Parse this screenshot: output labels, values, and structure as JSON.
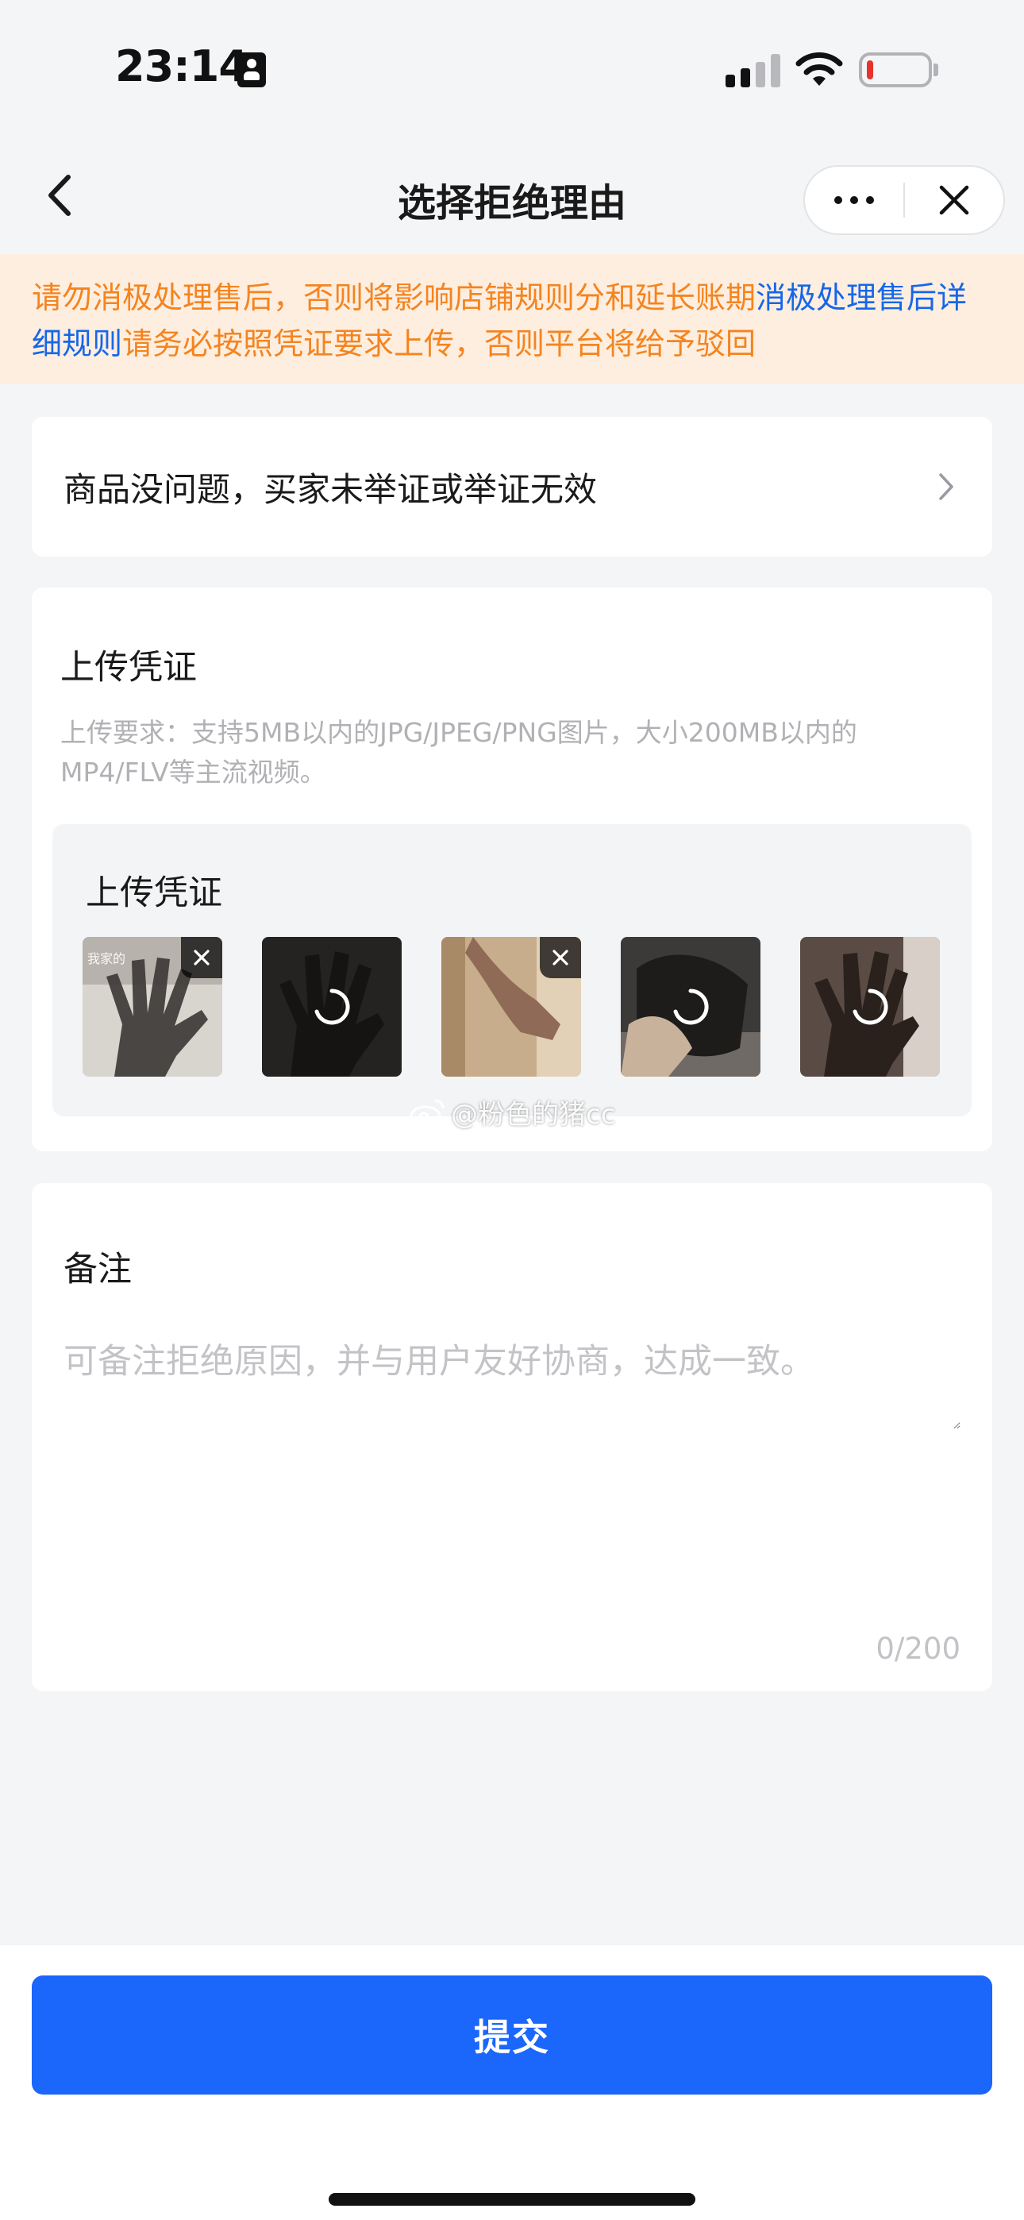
{
  "status_bar": {
    "time": "23:14",
    "battery_level": 0.1,
    "battery_color": "#e8322d",
    "icons": [
      "id-badge-icon",
      "cellular-signal-icon",
      "wifi-icon",
      "battery-icon"
    ]
  },
  "nav": {
    "title": "选择拒绝理由",
    "back_icon": "chevron-left-icon",
    "more_icon": "more-dots-icon",
    "close_icon": "close-icon"
  },
  "notice": {
    "text_1": "请勿消极处理售后，否则将影响店铺规则分和延长账期",
    "link": "消极处理售后详细规则",
    "text_2": "请务必按照凭证要求上传，否则平台将给予驳回",
    "text_color": "#f5841f",
    "link_color": "#1766e8"
  },
  "reason": {
    "label": "商品没问题，买家未举证或举证无效",
    "icon": "chevron-right-icon"
  },
  "upload": {
    "title": "上传凭证",
    "hint": "上传要求：支持5MB以内的JPG/JPEG/PNG图片，大小200MB以内的MP4/FLV等主流视频。",
    "box_title": "上传凭证",
    "thumbnails": [
      {
        "name": "proof-image-1",
        "state": "uploaded",
        "overlay_text": "我家的"
      },
      {
        "name": "proof-image-2",
        "state": "loading"
      },
      {
        "name": "proof-image-3",
        "state": "uploaded"
      },
      {
        "name": "proof-image-4",
        "state": "loading"
      },
      {
        "name": "proof-image-5",
        "state": "loading"
      }
    ]
  },
  "watermark": {
    "text": "@粉色的猪cc"
  },
  "remark": {
    "title": "备注",
    "placeholder": "可备注拒绝原因，并与用户友好协商，达成一致。",
    "value": "",
    "count": "0/200"
  },
  "footer": {
    "submit_label": "提交",
    "submit_color": "#1b66fb"
  }
}
